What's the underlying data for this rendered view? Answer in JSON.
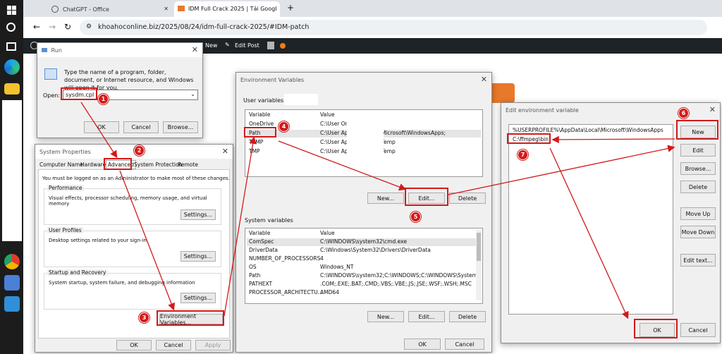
{
  "browser": {
    "tabs": [
      {
        "title": "ChatGPT - Office"
      },
      {
        "title": "IDM Full Crack 2025 | Tải Googl"
      }
    ],
    "url": "khoahoconline.biz/2025/08/24/idm-full-crack-2025/#IDM-patch"
  },
  "wpbar": {
    "new": "New",
    "edit_post": "Edit Post"
  },
  "run": {
    "title": "Run",
    "description": "Type the name of a program, folder, document, or Internet resource, and Windows will open it for you.",
    "open_label": "Open:",
    "open_value": "sysdm.cpl",
    "ok": "OK",
    "cancel": "Cancel",
    "browse": "Browse..."
  },
  "sysprops": {
    "title": "System Properties",
    "tabs": [
      "Computer Name",
      "Hardware",
      "Advanced",
      "System Protection",
      "Remote"
    ],
    "admin_note": "You must be logged on as an Administrator to make most of these changes.",
    "performance": {
      "label": "Performance",
      "text": "Visual effects, processor scheduling, memory usage, and virtual memory",
      "button": "Settings..."
    },
    "profiles": {
      "label": "User Profiles",
      "text": "Desktop settings related to your sign-in",
      "button": "Settings..."
    },
    "startup": {
      "label": "Startup and Recovery",
      "text": "System startup, system failure, and debugging information",
      "button": "Settings..."
    },
    "env_button": "Environment Variables...",
    "ok": "OK",
    "cancel": "Cancel",
    "apply": "Apply"
  },
  "envvars": {
    "title": "Environment Variables",
    "user_label": "User variables fo",
    "col_variable": "Variable",
    "col_value": "Value",
    "user_rows": [
      {
        "name": "OneDrive",
        "value": "C:\\User          OneDrive"
      },
      {
        "name": "Path",
        "value": "C:\\User          AppData\\Local\\Microsoft\\WindowsApps;"
      },
      {
        "name": "TEMP",
        "value": "C:\\User          AppData\\Local\\Temp"
      },
      {
        "name": "TMP",
        "value": "C:\\User          AppData\\Local\\Temp"
      }
    ],
    "user_new": "New...",
    "user_edit": "Edit...",
    "user_delete": "Delete",
    "system_label": "System variables",
    "system_rows": [
      {
        "name": "ComSpec",
        "value": "C:\\WINDOWS\\system32\\cmd.exe"
      },
      {
        "name": "DriverData",
        "value": "C:\\Windows\\System32\\Drivers\\DriverData"
      },
      {
        "name": "NUMBER_OF_PROCESSORS",
        "value": "4"
      },
      {
        "name": "OS",
        "value": "Windows_NT"
      },
      {
        "name": "Path",
        "value": "C:\\WINDOWS\\system32;C:\\WINDOWS;C:\\WINDOWS\\System3..."
      },
      {
        "name": "PATHEXT",
        "value": ".COM;.EXE;.BAT;.CMD;.VBS;.VBE;.JS;.JSE;.WSF;.WSH;.MSC"
      },
      {
        "name": "PROCESSOR_ARCHITECTU...",
        "value": "AMD64"
      }
    ],
    "sys_new": "New...",
    "sys_edit": "Edit...",
    "sys_delete": "Delete",
    "ok": "OK",
    "cancel": "Cancel"
  },
  "editenv": {
    "title": "Edit environment variable",
    "rows": [
      "%USERPROFILE%\\AppData\\Local\\Microsoft\\WindowsApps",
      "C:\\ffmpeg\\bin"
    ],
    "buttons": {
      "new": "New",
      "edit": "Edit",
      "browse": "Browse...",
      "delete": "Delete",
      "up": "Move Up",
      "down": "Move Down",
      "edit_text": "Edit text..."
    },
    "ok": "OK",
    "cancel": "Cancel"
  },
  "steps": [
    "1",
    "2",
    "3",
    "4",
    "5",
    "6",
    "7"
  ],
  "colors": {
    "accent": "#d21a1a",
    "taskbar": "#1c1c1c"
  }
}
